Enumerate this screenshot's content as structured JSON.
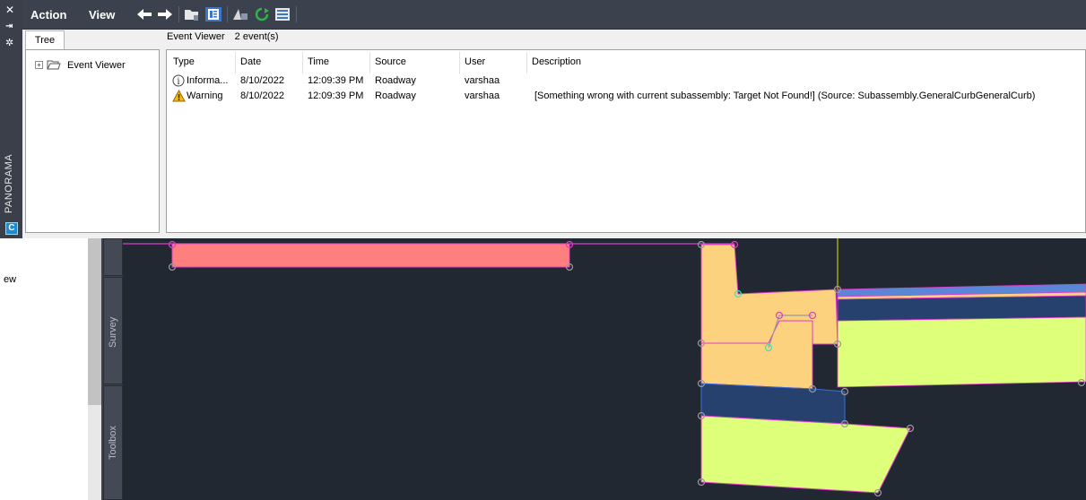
{
  "palette": {
    "name": "PANORAMA",
    "close_glyph": "✕",
    "menus": [
      "Action",
      "View"
    ],
    "toolbar_icons": [
      "back-arrow-icon",
      "forward-arrow-icon",
      "open-folder-icon",
      "panel-toggle-icon",
      "filter-icon",
      "refresh-icon",
      "list-view-icon"
    ]
  },
  "tree": {
    "tab_label": "Tree",
    "node_label": "Event Viewer"
  },
  "event_viewer": {
    "title": "Event Viewer",
    "count": "2 event(s)",
    "columns": [
      "Type",
      "Date",
      "Time",
      "Source",
      "User",
      "Description"
    ],
    "rows": [
      {
        "type": "Informa...",
        "type_icon": "info-icon",
        "date": "8/10/2022",
        "time": "12:09:39 PM",
        "source": "Roadway",
        "user": "varshaa",
        "description": ""
      },
      {
        "type": "Warning",
        "type_icon": "warning-icon",
        "date": "8/10/2022",
        "time": "12:09:39 PM",
        "source": "Roadway",
        "user": "varshaa",
        "description": "[Something wrong with current subassembly: Target Not Found!]  (Source: Subassembly.GeneralCurbGeneralCurb)"
      }
    ]
  },
  "tool_palette": {
    "left_fragment": "ew",
    "tabs": [
      "Survey",
      "Toolbox"
    ]
  },
  "colors": {
    "pink_fill": "#ff7f7f",
    "tan_fill": "#fdd27e",
    "navy_fill": "#27416e",
    "lime_fill": "#ddff7a",
    "blue_stripe": "#5b86d8",
    "magenta_edge": "#e03cc8",
    "background": "#222831"
  }
}
